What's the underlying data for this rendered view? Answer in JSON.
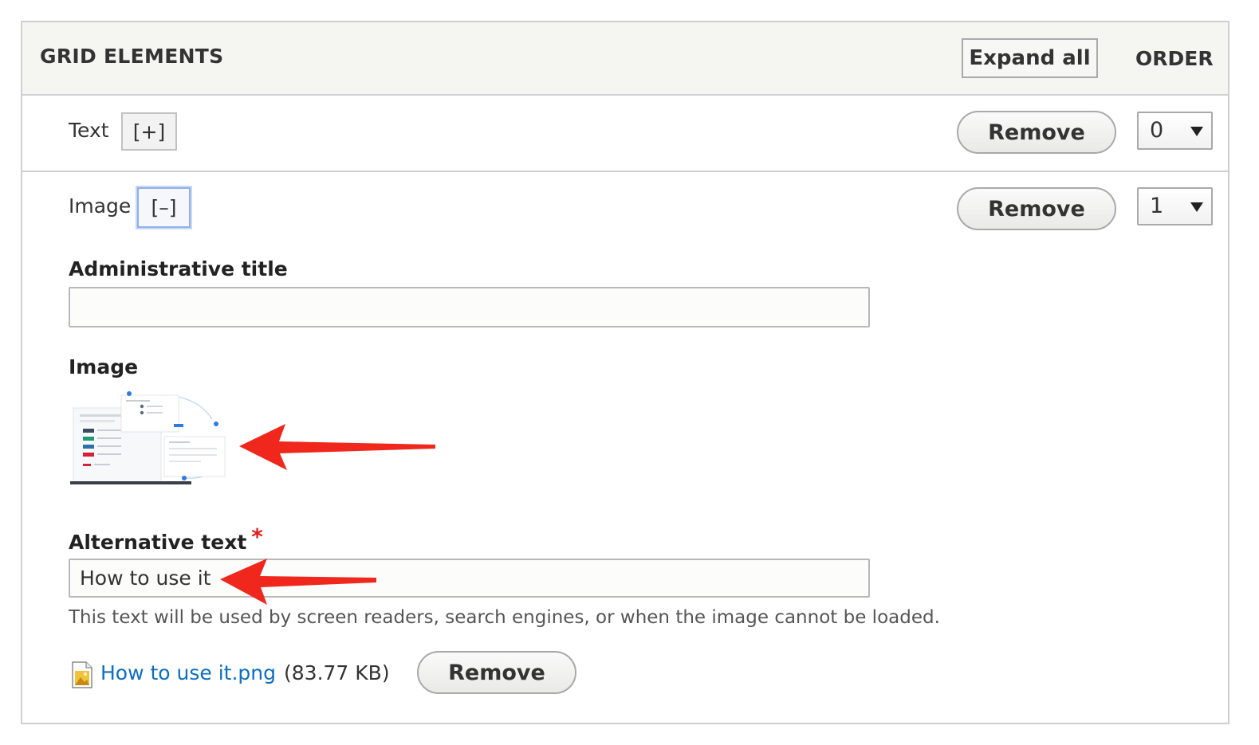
{
  "header": {
    "title": "GRID ELEMENTS",
    "expand_all_label": "Expand all",
    "order_label": "ORDER"
  },
  "elements": [
    {
      "label": "Text",
      "toggle": "[+]",
      "remove_label": "Remove",
      "order_value": "0"
    },
    {
      "label": "Image",
      "toggle": "[–]",
      "remove_label": "Remove",
      "order_value": "1"
    }
  ],
  "form": {
    "admin_title_label": "Administrative title",
    "admin_title_value": "",
    "image_label": "Image",
    "alt_text_label": "Alternative text",
    "required_marker": "*",
    "alt_text_value": "How to use it",
    "alt_text_help": "This text will be used by screen readers, search engines, or when the image cannot be loaded."
  },
  "file": {
    "icon": "image-file-icon",
    "name": "How to use it.png",
    "size": "(83.77 KB)",
    "remove_label": "Remove"
  },
  "colors": {
    "link": "#0b6ec2",
    "required": "#e41c1c",
    "annotation_arrow": "#f0271c",
    "header_bg": "#f5f5f2"
  }
}
